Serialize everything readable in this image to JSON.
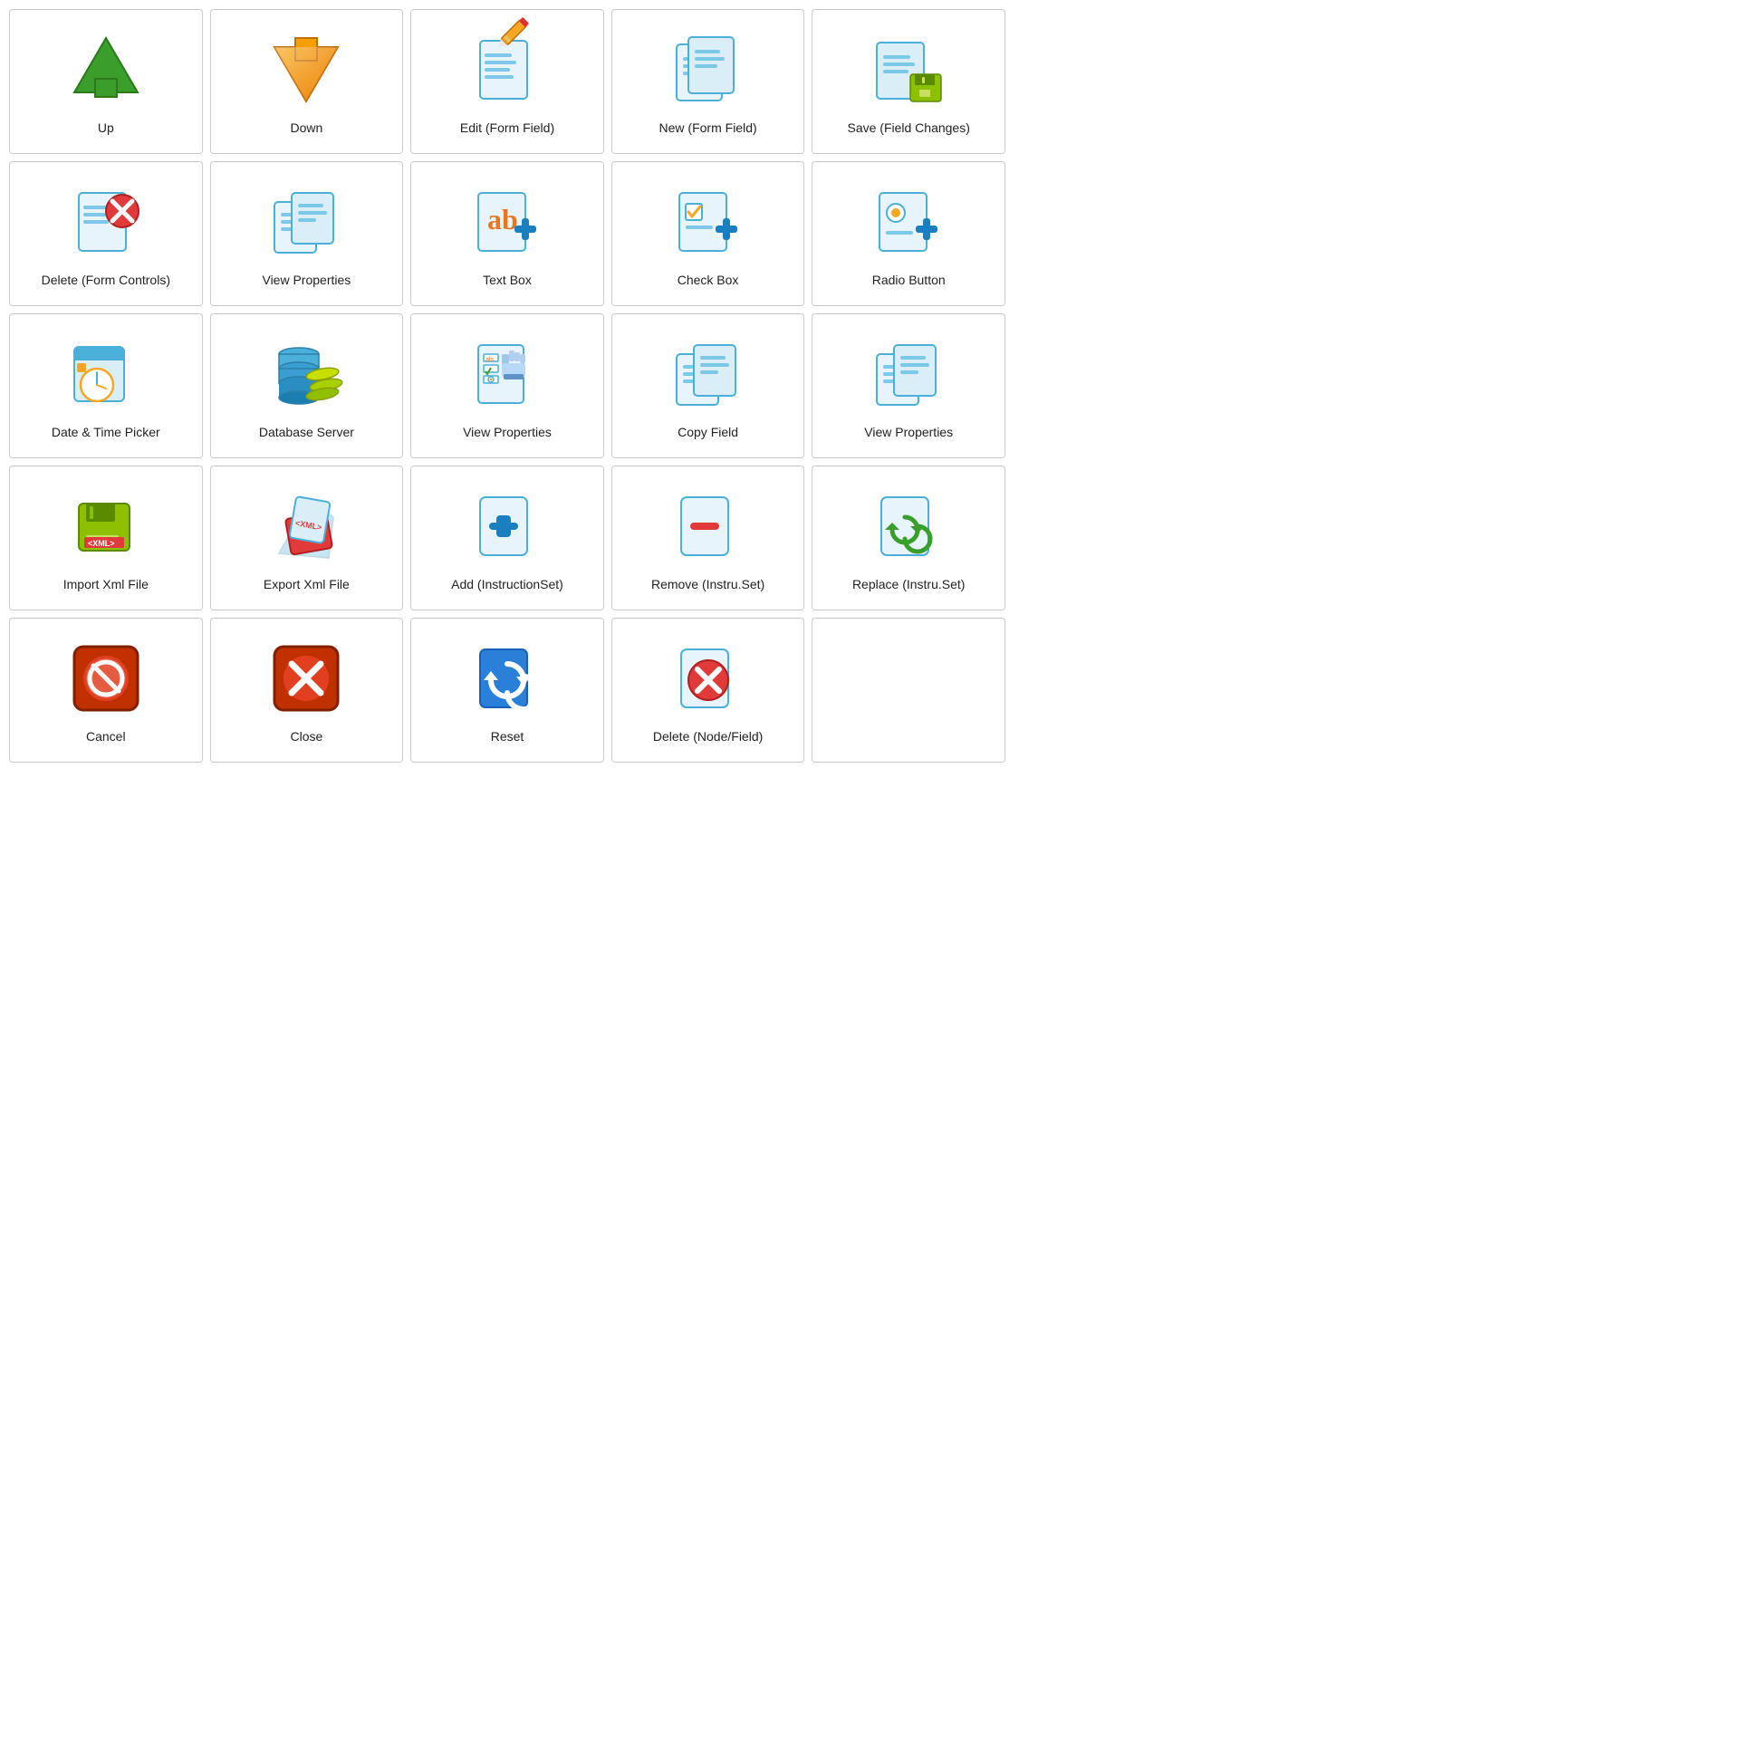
{
  "cells": [
    {
      "id": "up",
      "label": "Up",
      "icon": "up-arrow"
    },
    {
      "id": "down",
      "label": "Down",
      "icon": "down-arrow"
    },
    {
      "id": "edit-form-field",
      "label": "Edit\n(Form Field)",
      "icon": "edit-form"
    },
    {
      "id": "new-form-field",
      "label": "New\n(Form Field)",
      "icon": "new-form"
    },
    {
      "id": "save-field-changes",
      "label": "Save\n(Field Changes)",
      "icon": "save-floppy"
    },
    {
      "id": "delete-form-controls",
      "label": "Delete\n(Form Controls)",
      "icon": "delete-form"
    },
    {
      "id": "view-properties-1",
      "label": "View Properties",
      "icon": "view-props"
    },
    {
      "id": "text-box",
      "label": "Text Box",
      "icon": "text-box"
    },
    {
      "id": "check-box",
      "label": "Check Box",
      "icon": "check-box"
    },
    {
      "id": "radio-button",
      "label": "Radio Button",
      "icon": "radio-button"
    },
    {
      "id": "date-time-picker",
      "label": "Date & Time Picker",
      "icon": "datetime"
    },
    {
      "id": "database-server",
      "label": "Database Server",
      "icon": "database"
    },
    {
      "id": "view-properties-2",
      "label": "View Properties",
      "icon": "view-props2"
    },
    {
      "id": "copy-field",
      "label": "Copy Field",
      "icon": "copy-field"
    },
    {
      "id": "view-properties-3",
      "label": "View Properties",
      "icon": "view-props3"
    },
    {
      "id": "import-xml",
      "label": "Import Xml File",
      "icon": "import-xml"
    },
    {
      "id": "export-xml",
      "label": "Export Xml File",
      "icon": "export-xml"
    },
    {
      "id": "add-instruction",
      "label": "Add (InstructionSet)",
      "icon": "add-instr"
    },
    {
      "id": "remove-instruction",
      "label": "Remove (Instru.Set)",
      "icon": "remove-instr"
    },
    {
      "id": "replace-instruction",
      "label": "Replace (Instru.Set)",
      "icon": "replace-instr"
    },
    {
      "id": "cancel",
      "label": "Cancel",
      "icon": "cancel"
    },
    {
      "id": "close",
      "label": "Close",
      "icon": "close"
    },
    {
      "id": "reset",
      "label": "Reset",
      "icon": "reset"
    },
    {
      "id": "delete-node-field",
      "label": "Delete (Node/Field)",
      "icon": "delete-node"
    },
    {
      "id": "empty",
      "label": "",
      "icon": "none"
    }
  ]
}
